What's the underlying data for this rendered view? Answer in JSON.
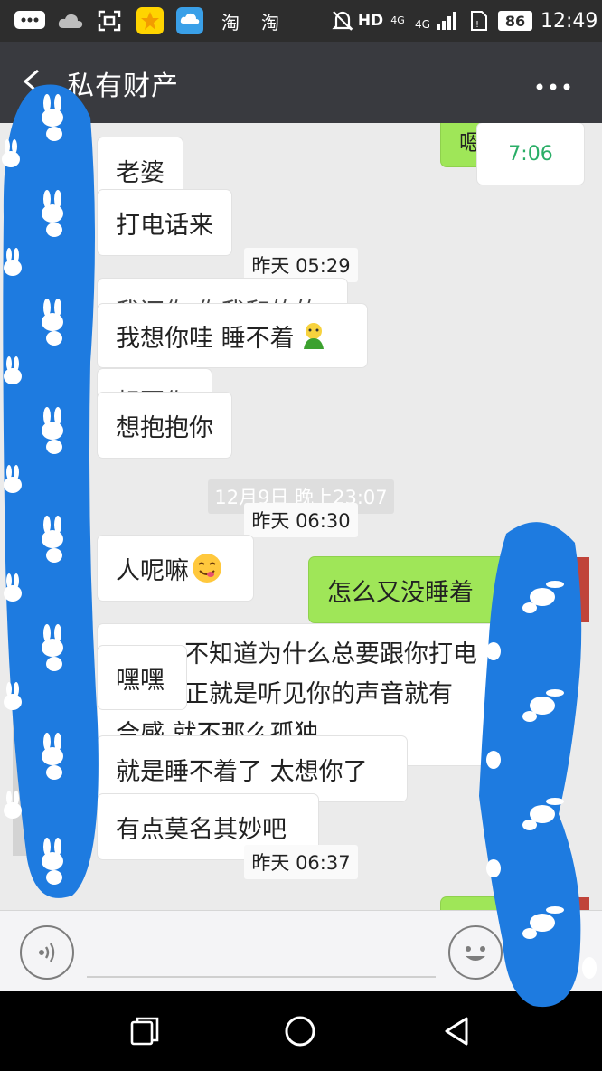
{
  "status_bar": {
    "left_icons": [
      "message-icon",
      "cloud-icon",
      "scan-icon",
      "star-app-icon",
      "weather-app-icon",
      "taobao-icon",
      "taobao-icon"
    ],
    "taobao_label": "淘",
    "hd": "HD",
    "network": "4G",
    "battery": "86",
    "time": "12:49"
  },
  "header": {
    "title": "私有财产",
    "back_icon": "back-arrow-icon",
    "more_icon": "more-dots-icon"
  },
  "messages": {
    "top_right_partial": "嗯",
    "top_right_time": "7:06",
    "m1": "老婆",
    "m2": "打电话来",
    "ts1": "昨天 05:29",
    "m3_hidden": "我还你 你我和的的",
    "m4": "我想你哇  睡不着",
    "m5_hidden": "想要你",
    "m6": "想抱抱你",
    "ts_faded": "12月9日 晚上23:07",
    "ts2": "昨天 06:30",
    "m7": "人呢嘛",
    "m8_sent": "怎么又没睡着",
    "m9_line1": "不知道为什么总要跟你打电",
    "m9_line2": "正就是听见你的声音就有",
    "m9_line3": "合感 就不那么孤独",
    "m10": "嘿嘿",
    "m11": "就是睡不着了 太想你了",
    "m12": "有点莫名其妙吧",
    "ts3": "昨天 06:37"
  },
  "input_bar": {
    "voice_icon": "voice-icon",
    "emoji_icon": "emoji-icon"
  },
  "nav_bar": {
    "recent_icon": "recent-apps-icon",
    "home_icon": "home-icon",
    "back_icon": "nav-back-icon"
  },
  "colors": {
    "scribble": "#1e7be0",
    "sent_bubble": "#9fe658",
    "title_bar": "#393a3f",
    "chat_bg": "#ebebeb"
  }
}
